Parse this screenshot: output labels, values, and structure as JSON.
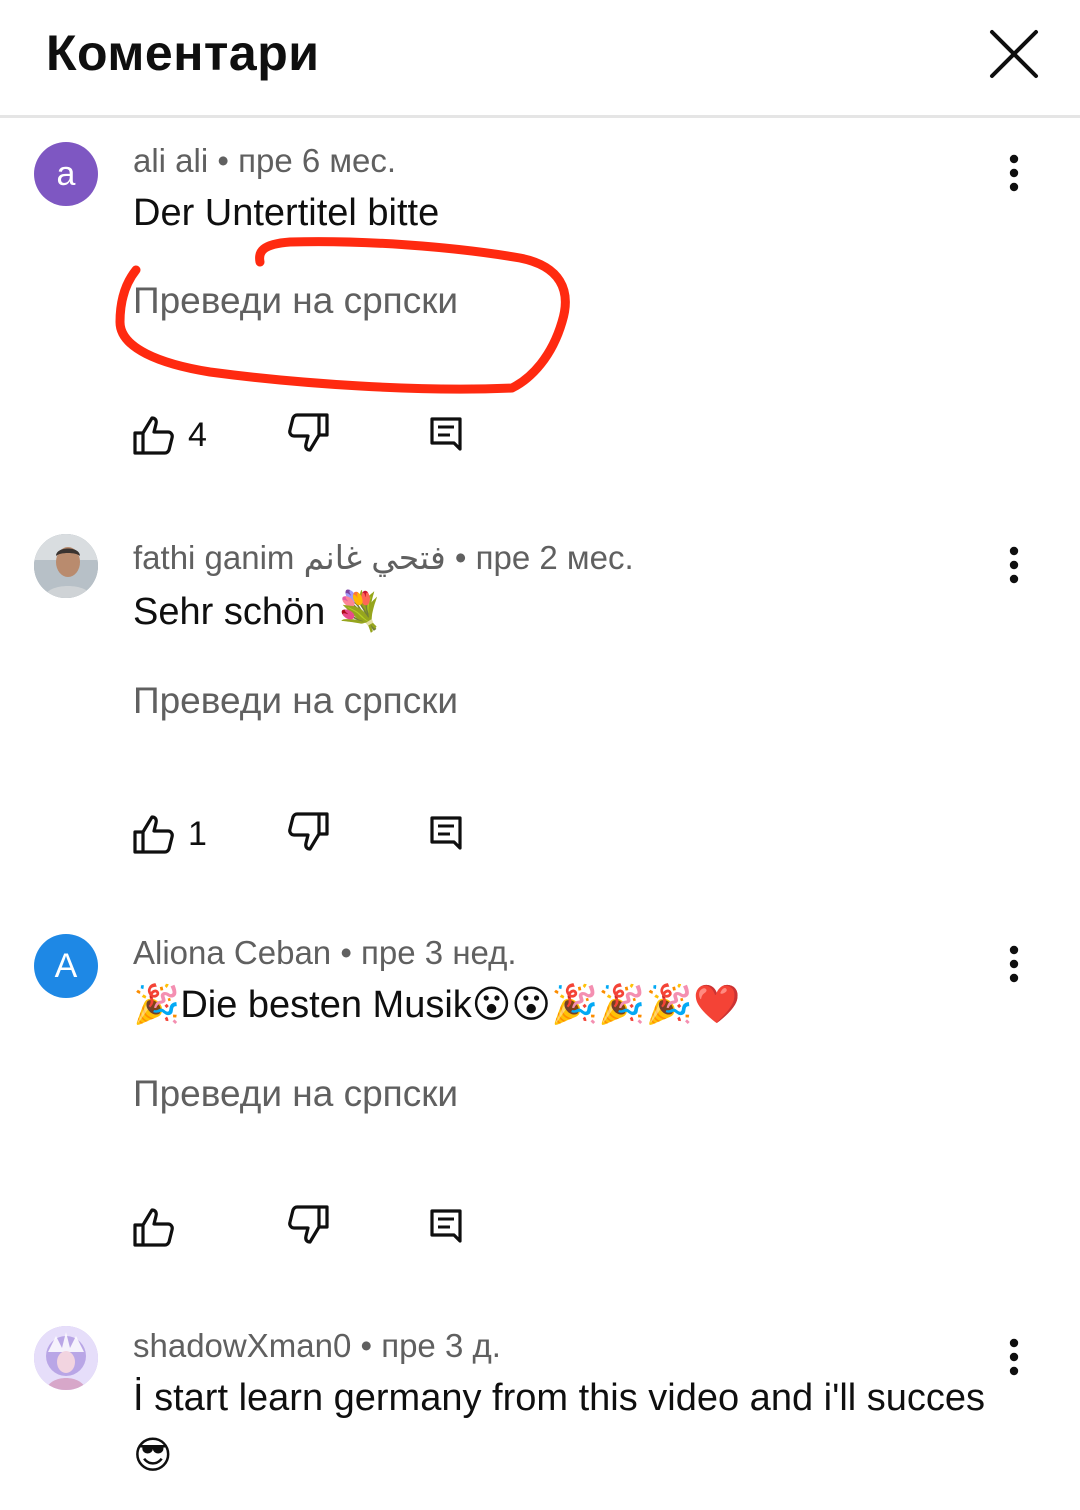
{
  "header": {
    "title": "Коментари"
  },
  "comments": [
    {
      "avatar_letter": "a",
      "avatar_color": "#7e57c2",
      "author": "ali ali",
      "time": "пре 6 мес.",
      "text": "Der Untertitel bitte",
      "translate": "Преведи на српски",
      "likes": "4"
    },
    {
      "avatar_letter": "",
      "avatar_color": "#9aa4ad",
      "author": "fathi ganim فتحي غانم",
      "time": "пре 2 мес.",
      "text": "Sehr schön 💐",
      "translate": "Преведи на српски",
      "likes": "1"
    },
    {
      "avatar_letter": "A",
      "avatar_color": "#1e88e5",
      "author": "Aliona Ceban",
      "time": "пре 3 нед.",
      "text": "🎉Die besten Musik😮😮🎉🎉🎉❤️",
      "translate": "Преведи на српски",
      "likes": ""
    },
    {
      "avatar_letter": "",
      "avatar_color": "#c9b8e8",
      "author": "shadowXman0",
      "time": "пре 3 д.",
      "text": "İ start learn germany from this video and i'll succes😎",
      "translate": "",
      "likes": ""
    }
  ],
  "meta_separator": " • ",
  "colors": {
    "annotation": "#ff2a10",
    "secondary_text": "#606060"
  }
}
